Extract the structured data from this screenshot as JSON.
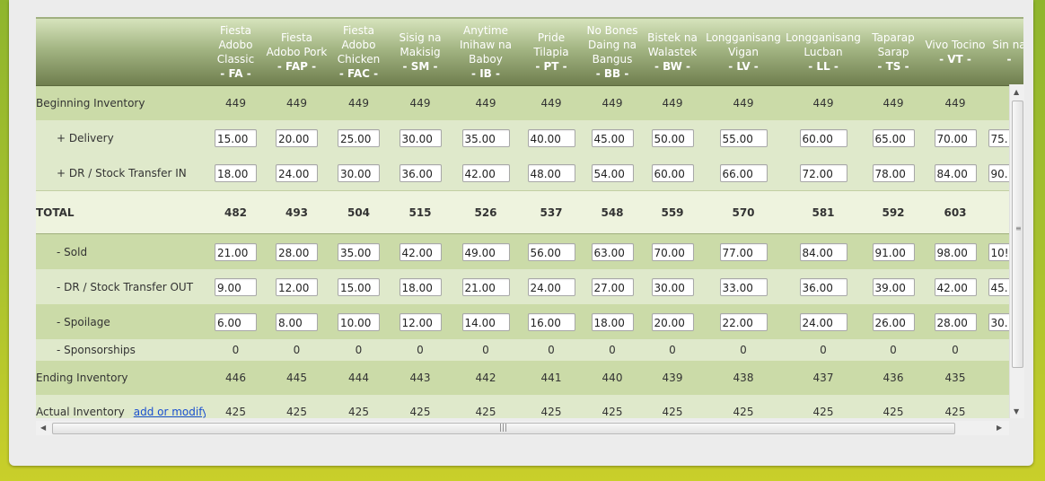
{
  "columns": [
    {
      "name": "Fiesta Adobo Classic",
      "code": "- FA -"
    },
    {
      "name": "Fiesta Adobo Pork",
      "code": "- FAP -"
    },
    {
      "name": "Fiesta Adobo Chicken",
      "code": "- FAC -"
    },
    {
      "name": "Sisig na Makisig",
      "code": "- SM -"
    },
    {
      "name": "Anytime Inihaw na Baboy",
      "code": "- IB -"
    },
    {
      "name": "Pride Tilapia",
      "code": "- PT -"
    },
    {
      "name": "No Bones Daing na Bangus",
      "code": "- BB -"
    },
    {
      "name": "Bistek na Walastek",
      "code": "- BW -"
    },
    {
      "name": "Longganisang Vigan",
      "code": "- LV -"
    },
    {
      "name": "Longganisang Lucban",
      "code": "- LL -"
    },
    {
      "name": "Taparap Sarap",
      "code": "- TS -"
    },
    {
      "name": "Vivo Tocino",
      "code": "- VT -"
    },
    {
      "name": "Sin na",
      "code": "-"
    }
  ],
  "rows": {
    "beginning": {
      "label": "Beginning Inventory",
      "values": [
        "449",
        "449",
        "449",
        "449",
        "449",
        "449",
        "449",
        "449",
        "449",
        "449",
        "449",
        "449",
        ""
      ]
    },
    "delivery": {
      "label": "+ Delivery",
      "values": [
        "15.00",
        "20.00",
        "25.00",
        "30.00",
        "35.00",
        "40.00",
        "45.00",
        "50.00",
        "55.00",
        "60.00",
        "65.00",
        "70.00",
        "75."
      ]
    },
    "dr_in": {
      "label": "+ DR / Stock Transfer IN",
      "values": [
        "18.00",
        "24.00",
        "30.00",
        "36.00",
        "42.00",
        "48.00",
        "54.00",
        "60.00",
        "66.00",
        "72.00",
        "78.00",
        "84.00",
        "90."
      ]
    },
    "total": {
      "label": "TOTAL",
      "values": [
        "482",
        "493",
        "504",
        "515",
        "526",
        "537",
        "548",
        "559",
        "570",
        "581",
        "592",
        "603",
        ""
      ]
    },
    "sold": {
      "label": "- Sold",
      "values": [
        "21.00",
        "28.00",
        "35.00",
        "42.00",
        "49.00",
        "56.00",
        "63.00",
        "70.00",
        "77.00",
        "84.00",
        "91.00",
        "98.00",
        "10!"
      ]
    },
    "dr_out": {
      "label": "- DR / Stock Transfer OUT",
      "values": [
        "9.00",
        "12.00",
        "15.00",
        "18.00",
        "21.00",
        "24.00",
        "27.00",
        "30.00",
        "33.00",
        "36.00",
        "39.00",
        "42.00",
        "45."
      ]
    },
    "spoilage": {
      "label": "- Spoilage",
      "values": [
        "6.00",
        "8.00",
        "10.00",
        "12.00",
        "14.00",
        "16.00",
        "18.00",
        "20.00",
        "22.00",
        "24.00",
        "26.00",
        "28.00",
        "30."
      ]
    },
    "sponsorships": {
      "label": "- Sponsorships",
      "values": [
        "0",
        "0",
        "0",
        "0",
        "0",
        "0",
        "0",
        "0",
        "0",
        "0",
        "0",
        "0",
        ""
      ]
    },
    "ending": {
      "label": "Ending Inventory",
      "values": [
        "446",
        "445",
        "444",
        "443",
        "442",
        "441",
        "440",
        "439",
        "438",
        "437",
        "436",
        "435",
        ""
      ]
    },
    "actual": {
      "label": "Actual Inventory",
      "link": "add or modify",
      "values": [
        "425",
        "425",
        "425",
        "425",
        "425",
        "425",
        "425",
        "425",
        "425",
        "425",
        "425",
        "425",
        ""
      ]
    }
  },
  "icons": {
    "scroll_up": "▲",
    "scroll_down": "▼",
    "scroll_left": "◀",
    "scroll_right": "▶",
    "grip_v": "≡",
    "grip_h": "|||"
  }
}
